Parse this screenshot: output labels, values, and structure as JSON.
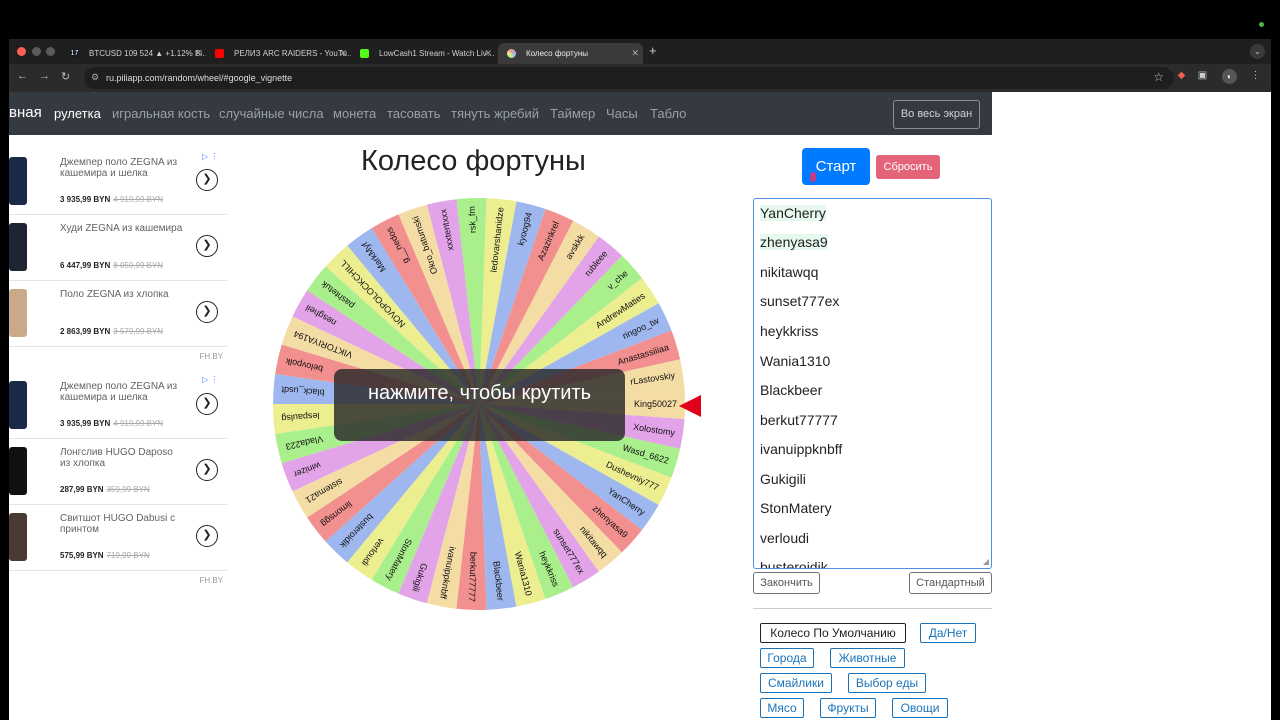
{
  "browser": {
    "tabs": [
      {
        "title": "BTCUSD 109 524 ▲ +1.12% Bi…",
        "color": "#222"
      },
      {
        "title": "РЕЛИЗ ARC RAIDERS - YouTu…",
        "color": "#ff0000"
      },
      {
        "title": "LowCash1 Stream - Watch Liv…",
        "color": "#53fc18"
      },
      {
        "title": "Колесо фортуны",
        "color": "#8b6bd1"
      }
    ],
    "url": "ru.piliapp.com/random/wheel/#google_vignette"
  },
  "sitenav": {
    "brand": "вная",
    "links": [
      "рулетка",
      "игральная кость",
      "случайные числа",
      "монета",
      "тасовать",
      "тянуть жребий",
      "Таймер",
      "Часы",
      "Табло"
    ],
    "fullscreen": "Во весь экран"
  },
  "ads": [
    {
      "title": "Джемпер поло ZEGNA из кашемира и шелка",
      "price": "3 935,99 BYN",
      "old": "4 919,99 BYN",
      "color": "#1c2a4a"
    },
    {
      "title": "Худи ZEGNA из кашемира",
      "price": "6 447,99 BYN",
      "old": "8 059,99 BYN",
      "color": "#1e2433"
    },
    {
      "title": "Поло ZEGNA из хлопка",
      "price": "2 863,99 BYN",
      "old": "3 579,99 BYN",
      "color": "#c9a98a"
    },
    {
      "title": "Джемпер поло ZEGNA из кашемира и шелка",
      "price": "3 935,99 BYN",
      "old": "4 919,99 BYN",
      "color": "#1c2a4a"
    },
    {
      "title": "Лонгслив HUGO Daposo из хлопка",
      "price": "287,99 BYN",
      "old": "359,99 BYN",
      "color": "#111"
    },
    {
      "title": "Свитшот HUGO Dabusi с принтом",
      "price": "575,99 BYN",
      "old": "719,99 BYN",
      "color": "#4a3a32"
    }
  ],
  "ads_source": "FH.BY",
  "main": {
    "title": "Колесо фортуны",
    "overlay": "нажмите, чтобы крутить",
    "start": "Старт",
    "reset": "Сбросить",
    "finish": "Закончить",
    "standard": "Стандартный"
  },
  "wheel": {
    "colors": [
      "#f4dca5",
      "#f28f8f",
      "#9fb7ef",
      "#ecee8f",
      "#a9f08c",
      "#e2a3e8"
    ],
    "names": [
      "rLastovskiy",
      "Anastassiiiaa",
      "ringoo_tw",
      "AndrewMaties",
      "v_che",
      "rubleee",
      "avskkk",
      "Azazinkrel",
      "kyoog94",
      "ledovarshanidze",
      "rsk_fm",
      "xxxtentxxx",
      "Okro_batumski",
      "g__nedos",
      "MarkMyf",
      "NOVOPOLOCKCHILL",
      "pashtetuk",
      "nesgheil",
      "VIKTORIYA194",
      "belovpolk",
      "black_usdt",
      "lespaulsg",
      "Vlada223",
      "winizer",
      "sistema21",
      "limonsgg",
      "busteroidik",
      "verloudi",
      "StonMatery",
      "Gukigili",
      "ivanuippknbff",
      "berkut77777",
      "Blackbeer",
      "Wania1310",
      "heykkriss",
      "sunset777ex",
      "nikitawqq",
      "zhenyasa9",
      "YanCherry",
      "Dushevniy777",
      "Wasd_6622",
      "Xolostomy",
      "King50027"
    ]
  },
  "names_list": [
    "YanCherry",
    "zhenyasa9",
    "nikitawqq",
    "sunset777ex",
    "heykkriss",
    "Wania1310",
    "Blackbeer",
    "berkut77777",
    "ivanuippknbff",
    "Gukigili",
    "StonMatery",
    "verloudi",
    "busteroidik"
  ],
  "presets": [
    "Колесо По Умолчанию",
    "Да/Нет",
    "Города",
    "Животные",
    "Смайлики",
    "Выбор еды",
    "Мясо",
    "Фрукты",
    "Овощи"
  ]
}
